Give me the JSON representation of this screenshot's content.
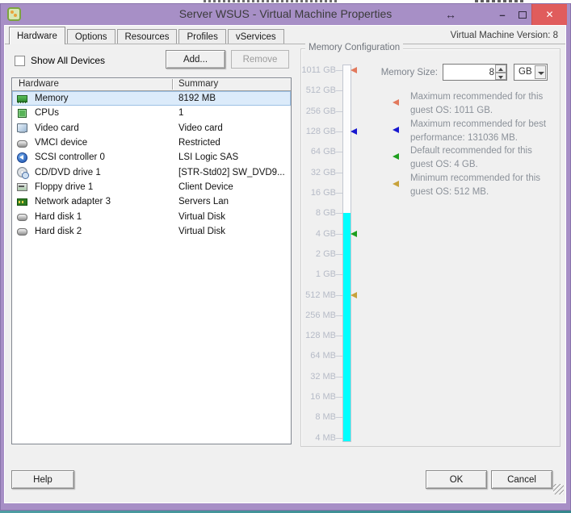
{
  "window": {
    "title": "Server WSUS - Virtual Machine Properties",
    "version_label": "Virtual Machine Version: 8",
    "controls": {
      "resize_glyph": "↔",
      "minimize_glyph": "–",
      "close_glyph": "✕"
    }
  },
  "tabs": [
    {
      "label": "Hardware",
      "active": true
    },
    {
      "label": "Options"
    },
    {
      "label": "Resources"
    },
    {
      "label": "Profiles"
    },
    {
      "label": "vServices"
    }
  ],
  "device_panel": {
    "show_all_devices_label": "Show All Devices",
    "add_button_label": "Add...",
    "remove_button_label": "Remove",
    "columns": [
      "Hardware",
      "Summary"
    ],
    "rows": [
      {
        "icon": "memory-icon",
        "name": "Memory",
        "summary": "8192 MB",
        "selected": true
      },
      {
        "icon": "cpu-icon",
        "name": "CPUs",
        "summary": "1"
      },
      {
        "icon": "video-icon",
        "name": "Video card",
        "summary": "Video card"
      },
      {
        "icon": "vmci-icon",
        "name": "VMCI device",
        "summary": "Restricted"
      },
      {
        "icon": "scsi-icon",
        "name": "SCSI controller 0",
        "summary": "LSI Logic SAS"
      },
      {
        "icon": "cd-icon",
        "name": "CD/DVD drive 1",
        "summary": "[STR-Std02] SW_DVD9..."
      },
      {
        "icon": "floppy-icon",
        "name": "Floppy drive 1",
        "summary": "Client Device"
      },
      {
        "icon": "network-icon",
        "name": "Network adapter 3",
        "summary": "Servers Lan"
      },
      {
        "icon": "disk-icon",
        "name": "Hard disk 1",
        "summary": "Virtual Disk"
      },
      {
        "icon": "disk-icon",
        "name": "Hard disk 2",
        "summary": "Virtual Disk"
      }
    ]
  },
  "memory_config": {
    "group_title": "Memory Configuration",
    "memory_size_label": "Memory Size:",
    "memory_size_value": "8",
    "memory_size_unit": "GB",
    "scale_ticks": [
      "1011 GB",
      "512 GB",
      "256 GB",
      "128 GB",
      "64 GB",
      "32 GB",
      "16 GB",
      "8 GB",
      "4 GB",
      "2 GB",
      "1 GB",
      "512 MB",
      "256 MB",
      "128 MB",
      "64 MB",
      "32 MB",
      "16 MB",
      "8 MB",
      "4 MB"
    ],
    "bar_fill_from_tick": "8 GB",
    "bar_color": "#00FFFF",
    "markers": [
      {
        "tick": "1011 GB",
        "color": "#E2795C",
        "label": "maximum-guest-os"
      },
      {
        "tick": "128 GB",
        "color": "#1717CF",
        "label": "maximum-performance"
      },
      {
        "tick": "4 GB",
        "color": "#1E9E1E",
        "label": "default-guest-os"
      },
      {
        "tick": "512 MB",
        "color": "#C8A23C",
        "label": "minimum-guest-os"
      }
    ],
    "notes": [
      {
        "color": "#E2795C",
        "text": "Maximum recommended for this guest OS: 1011 GB."
      },
      {
        "color": "#1717CF",
        "text": "Maximum recommended for best performance: 131036 MB."
      },
      {
        "color": "#1E9E1E",
        "text": "Default recommended for this guest OS: 4 GB."
      },
      {
        "color": "#C8A23C",
        "text": "Minimum recommended for this guest OS: 512 MB."
      }
    ]
  },
  "footer": {
    "help_label": "Help",
    "ok_label": "OK",
    "cancel_label": "Cancel"
  }
}
